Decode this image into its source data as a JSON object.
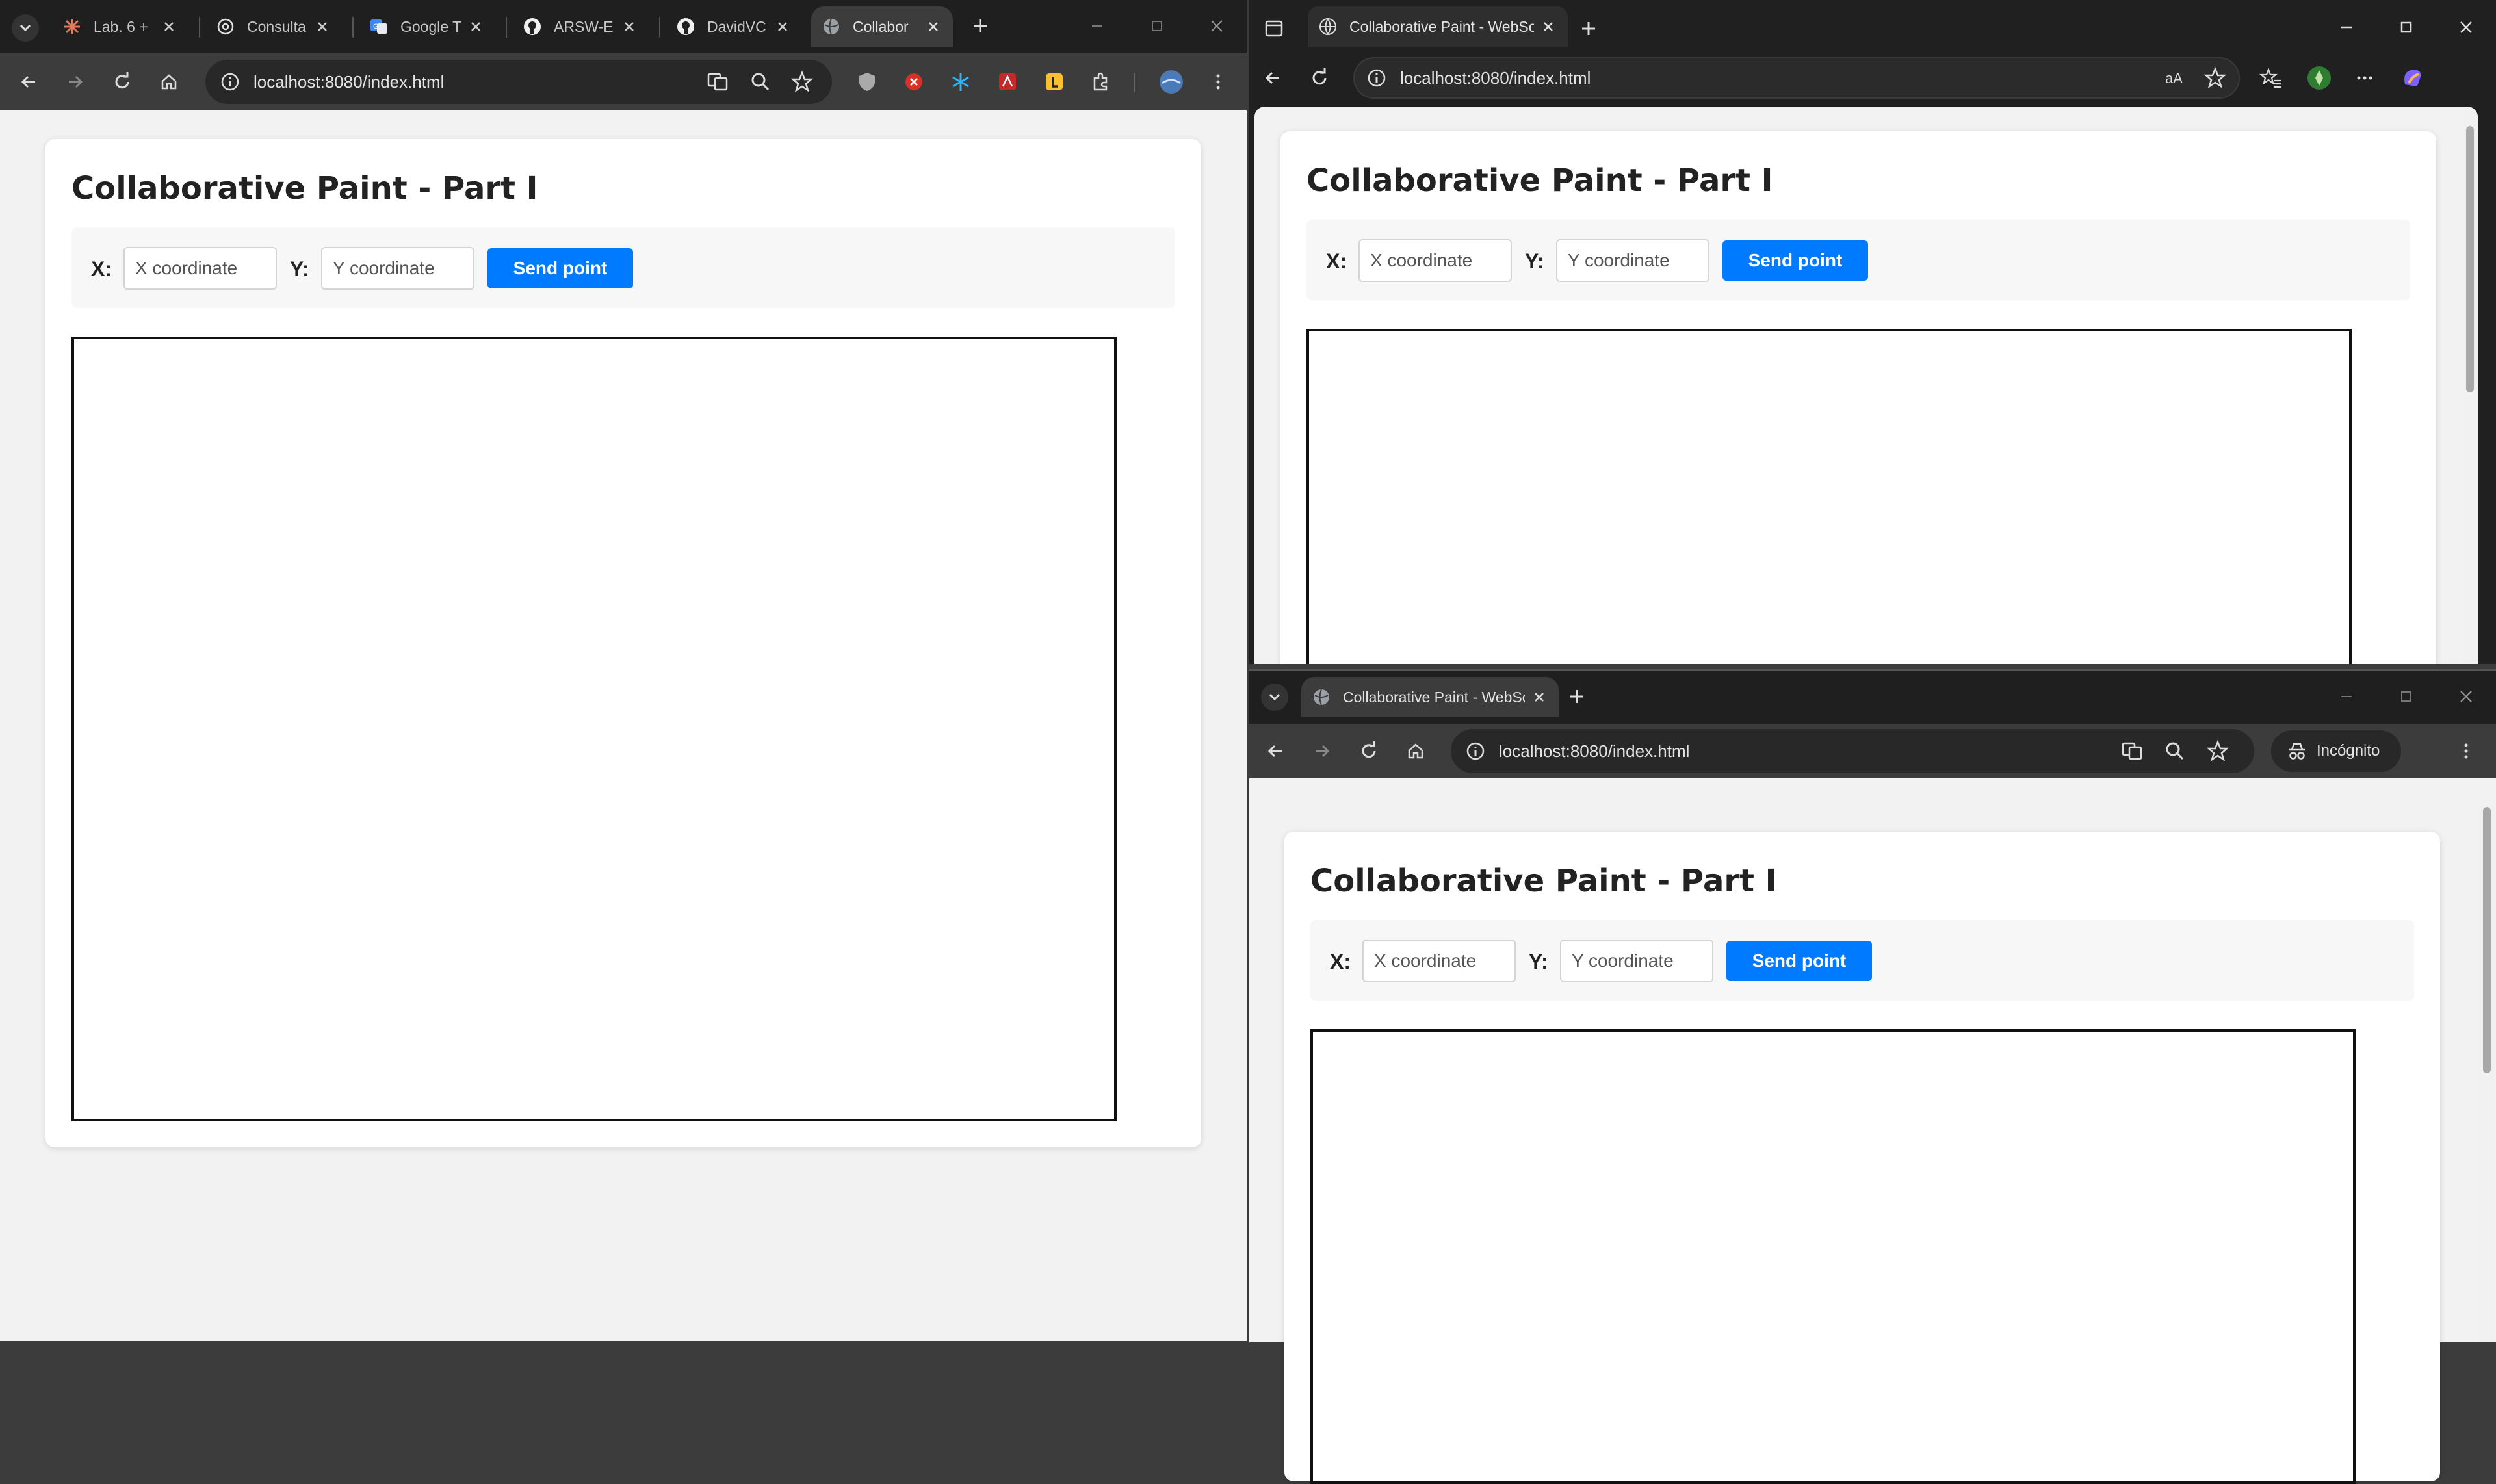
{
  "left_window": {
    "tabs": [
      {
        "title": "Lab. 6 +",
        "icon": "claude-icon",
        "active": false
      },
      {
        "title": "Consulta",
        "icon": "chatgpt-icon",
        "active": false
      },
      {
        "title": "Google T",
        "icon": "google-translate-icon",
        "active": false
      },
      {
        "title": "ARSW-E",
        "icon": "github-icon",
        "active": false
      },
      {
        "title": "DavidVC",
        "icon": "github-icon",
        "active": false
      },
      {
        "title": "Collabor",
        "icon": "globe-icon",
        "active": true
      }
    ],
    "url": "localhost:8080/index.html"
  },
  "right_top_window": {
    "tab_title": "Collaborative Paint - WebSockets",
    "url": "localhost:8080/index.html"
  },
  "right_bottom_window": {
    "tab_title": "Collaborative Paint - WebSockets",
    "url": "localhost:8080/index.html",
    "incognito_label": "Incógnito"
  },
  "page": {
    "title": "Collaborative Paint - Part I",
    "x_label": "X:",
    "y_label": "Y:",
    "x_placeholder": "X coordinate",
    "y_placeholder": "Y coordinate",
    "send_label": "Send point"
  },
  "colors": {
    "accent": "#007bff",
    "browser_dark": "#1f1f1f",
    "page_bg": "#f2f2f2"
  }
}
